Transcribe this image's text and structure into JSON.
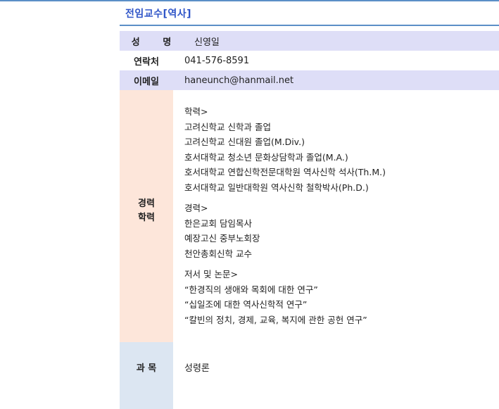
{
  "header": {
    "title": "전임교수[역사]"
  },
  "profile": {
    "name_label": "성 명",
    "name_value": "신영일",
    "contact_label": "연락처",
    "contact_value": "041-576-8591",
    "email_label": "이메일",
    "email_value": "haneunch@hanmail.net"
  },
  "career": {
    "label_line1": "경력",
    "label_line2": "학력",
    "education_heading": "학력>",
    "education": [
      "고려신학교 신학과 졸업",
      "고려신학교 신대원 졸업(M.Div.)",
      "호서대학교 청소년 문화상담학과 졸업(M.A.)",
      "호서대학교 연합신학전문대학원 역사신학 석사(Th.M.)",
      "호서대학교 일반대학원 역사신학 철학박사(Ph.D.)"
    ],
    "experience_heading": "경력>",
    "experience": [
      "한은교회 담임목사",
      "예장고신 중부노회장",
      "천안총회신학 교수"
    ],
    "publications_heading": "저서 및 논문>",
    "publications": [
      "“한경직의 생애와 목회에 대한 연구”",
      "“십일조에 대한 역사신학적 연구”",
      "“칼빈의 정치, 경제, 교육, 복지에 관한 공헌 연구”"
    ]
  },
  "subject": {
    "label": "과 목",
    "value": "성령론"
  },
  "colors": {
    "title": "#2f55c8",
    "rule": "#5b8fc7",
    "label_purple": "#dedef7",
    "label_peach": "#fde6da",
    "label_blue": "#dce6f2"
  }
}
